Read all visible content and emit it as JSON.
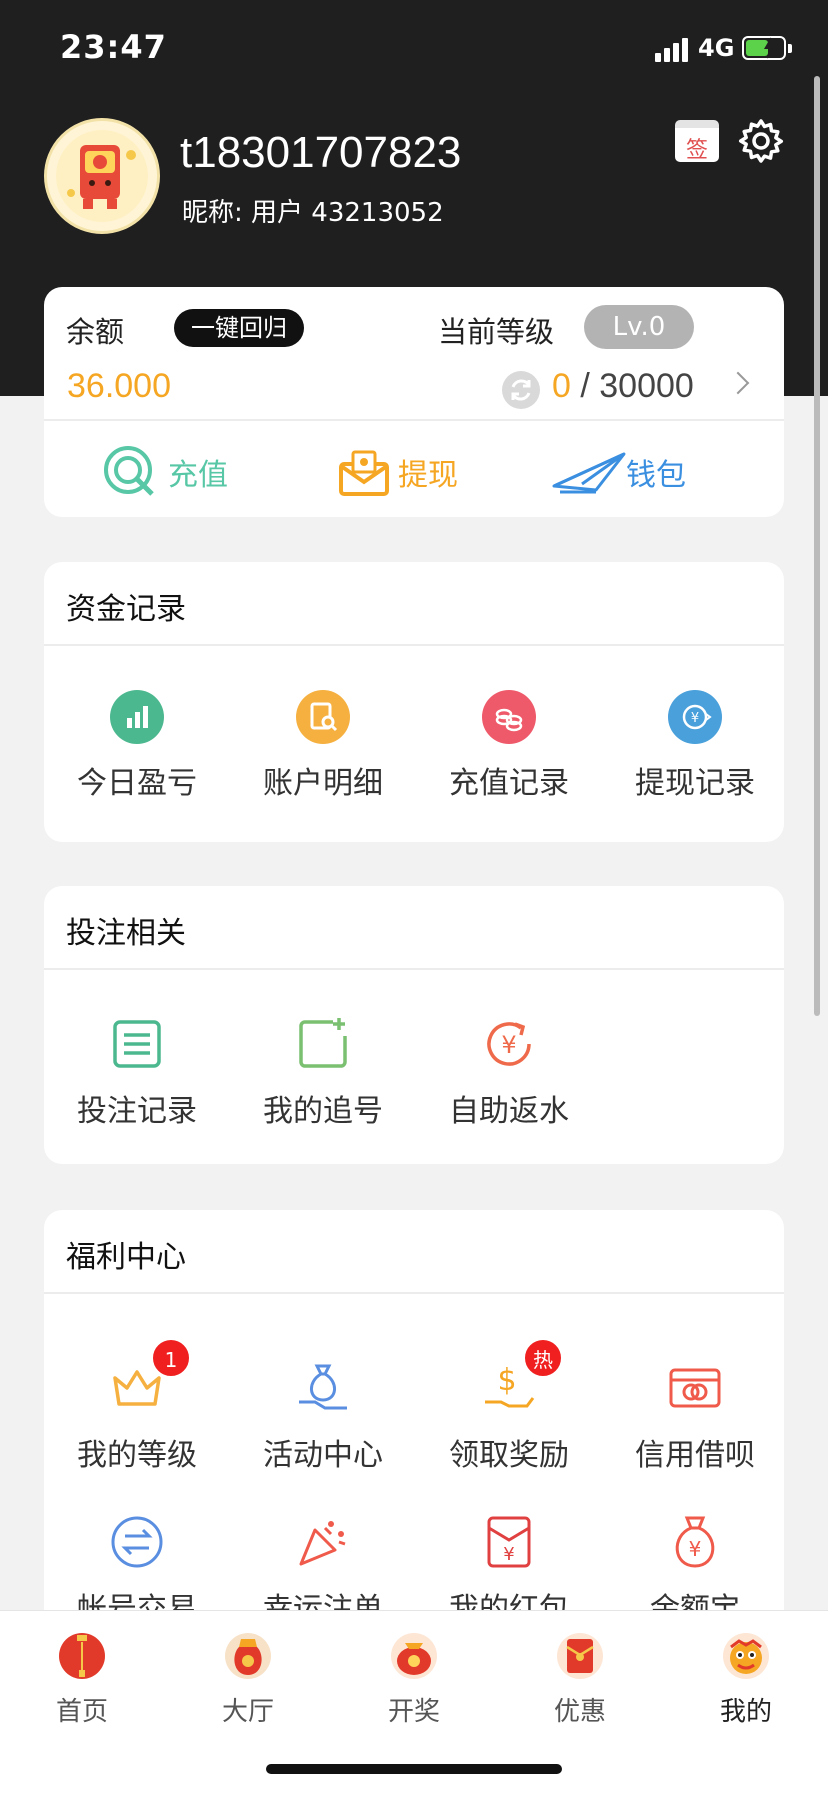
{
  "status_bar": {
    "time": "23:47",
    "network": "4G"
  },
  "profile": {
    "username": "t18301707823",
    "nickname": "昵称: 用户 43213052",
    "sign_icon_text": "签"
  },
  "balance_card": {
    "balance_label": "余额",
    "return_button": "一键回归",
    "level_label": "当前等级",
    "level_value": "Lv.0",
    "balance_value": "36.000",
    "level_current": "0",
    "level_separator": " / ",
    "level_target": "30000",
    "actions": [
      {
        "label": "充值",
        "color": "#57c7a6"
      },
      {
        "label": "提现",
        "color": "#f5a623"
      },
      {
        "label": "钱包",
        "color": "#3b8fe0"
      }
    ]
  },
  "funds_section": {
    "title": "资金记录",
    "items": [
      {
        "label": "今日盈亏",
        "icon": "bar-chart-icon",
        "color": "#4cb88f"
      },
      {
        "label": "账户明细",
        "icon": "document-search-icon",
        "color": "#f5b040"
      },
      {
        "label": "充值记录",
        "icon": "coins-icon",
        "color": "#ef5a6a"
      },
      {
        "label": "提现记录",
        "icon": "yen-exchange-icon",
        "color": "#4aa0db"
      }
    ]
  },
  "bet_section": {
    "title": "投注相关",
    "items": [
      {
        "label": "投注记录",
        "icon": "list-icon",
        "color": "#4cb88f"
      },
      {
        "label": "我的追号",
        "icon": "add-note-icon",
        "color": "#7ac070"
      },
      {
        "label": "自助返水",
        "icon": "yen-refresh-icon",
        "color": "#ef6a4a"
      }
    ]
  },
  "welfare_section": {
    "title": "福利中心",
    "items": [
      {
        "label": "我的等级",
        "icon": "crown-icon",
        "color": "#f5b040",
        "badge": "1"
      },
      {
        "label": "活动中心",
        "icon": "money-bag-hand-icon",
        "color": "#5a8ee0",
        "badge": ""
      },
      {
        "label": "领取奖励",
        "icon": "dollar-hand-icon",
        "color": "#f5a623",
        "badge": "热"
      },
      {
        "label": "信用借呗",
        "icon": "credit-card-icon",
        "color": "#ef5a4a",
        "badge": ""
      },
      {
        "label": "帐号交易",
        "icon": "exchange-icon",
        "color": "#5a8ee0",
        "badge": ""
      },
      {
        "label": "幸运注单",
        "icon": "party-popper-icon",
        "color": "#ef5a4a",
        "badge": ""
      },
      {
        "label": "我的红包",
        "icon": "red-envelope-icon",
        "color": "#e04040",
        "badge": ""
      },
      {
        "label": "余额宝",
        "icon": "yen-bag-icon",
        "color": "#ef5a4a",
        "badge": ""
      }
    ]
  },
  "tabbar": {
    "tabs": [
      {
        "label": "首页",
        "icon": "lantern-icon",
        "active": false
      },
      {
        "label": "大厅",
        "icon": "lucky-bag-icon",
        "active": false
      },
      {
        "label": "开奖",
        "icon": "prize-pouch-icon",
        "active": false
      },
      {
        "label": "优惠",
        "icon": "red-packet-icon",
        "active": false
      },
      {
        "label": "我的",
        "icon": "lion-dance-icon",
        "active": true
      }
    ]
  }
}
